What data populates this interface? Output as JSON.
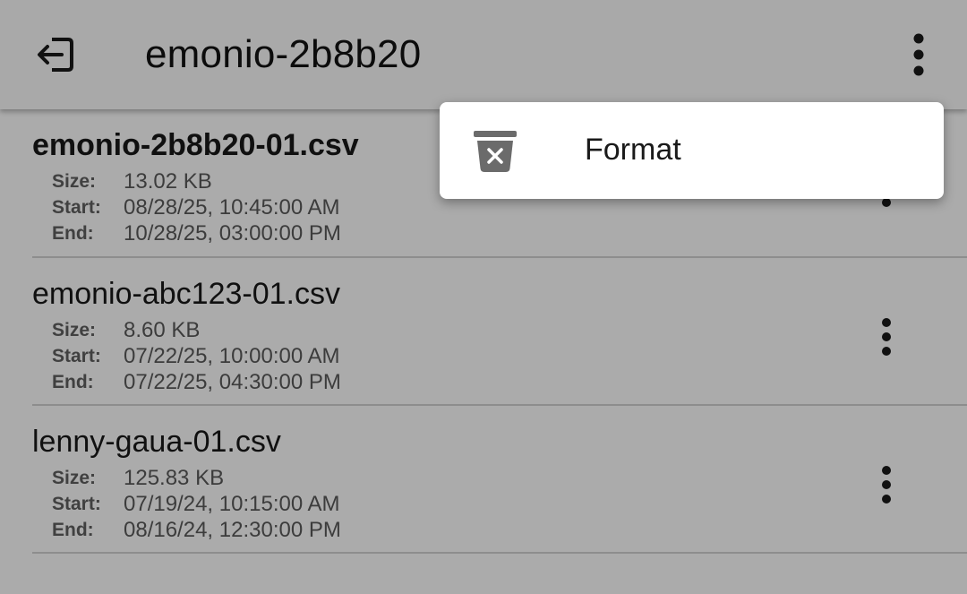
{
  "app_bar": {
    "title": "emonio-2b8b20",
    "back_icon": "exit-icon",
    "overflow_icon": "more-vert-icon"
  },
  "labels": {
    "size": "Size:",
    "start": "Start:",
    "end": "End:"
  },
  "files": [
    {
      "name": "emonio-2b8b20-01.csv",
      "size": "13.02 KB",
      "start": "08/28/25, 10:45:00 AM",
      "end": "10/28/25, 03:00:00 PM"
    },
    {
      "name": "emonio-abc123-01.csv",
      "size": "8.60 KB",
      "start": "07/22/25, 10:00:00 AM",
      "end": "07/22/25, 04:30:00 PM"
    },
    {
      "name": "lenny-gaua-01.csv",
      "size": "125.83 KB",
      "start": "07/19/24, 10:15:00 AM",
      "end": "08/16/24, 12:30:00 PM"
    }
  ],
  "popup_menu": {
    "items": [
      {
        "label": "Format",
        "icon": "delete-x-icon"
      }
    ]
  },
  "colors": {
    "scrim_background": "#ababab",
    "menu_background": "#ffffff",
    "text": "#101010",
    "divider": "#8d8d8d"
  }
}
